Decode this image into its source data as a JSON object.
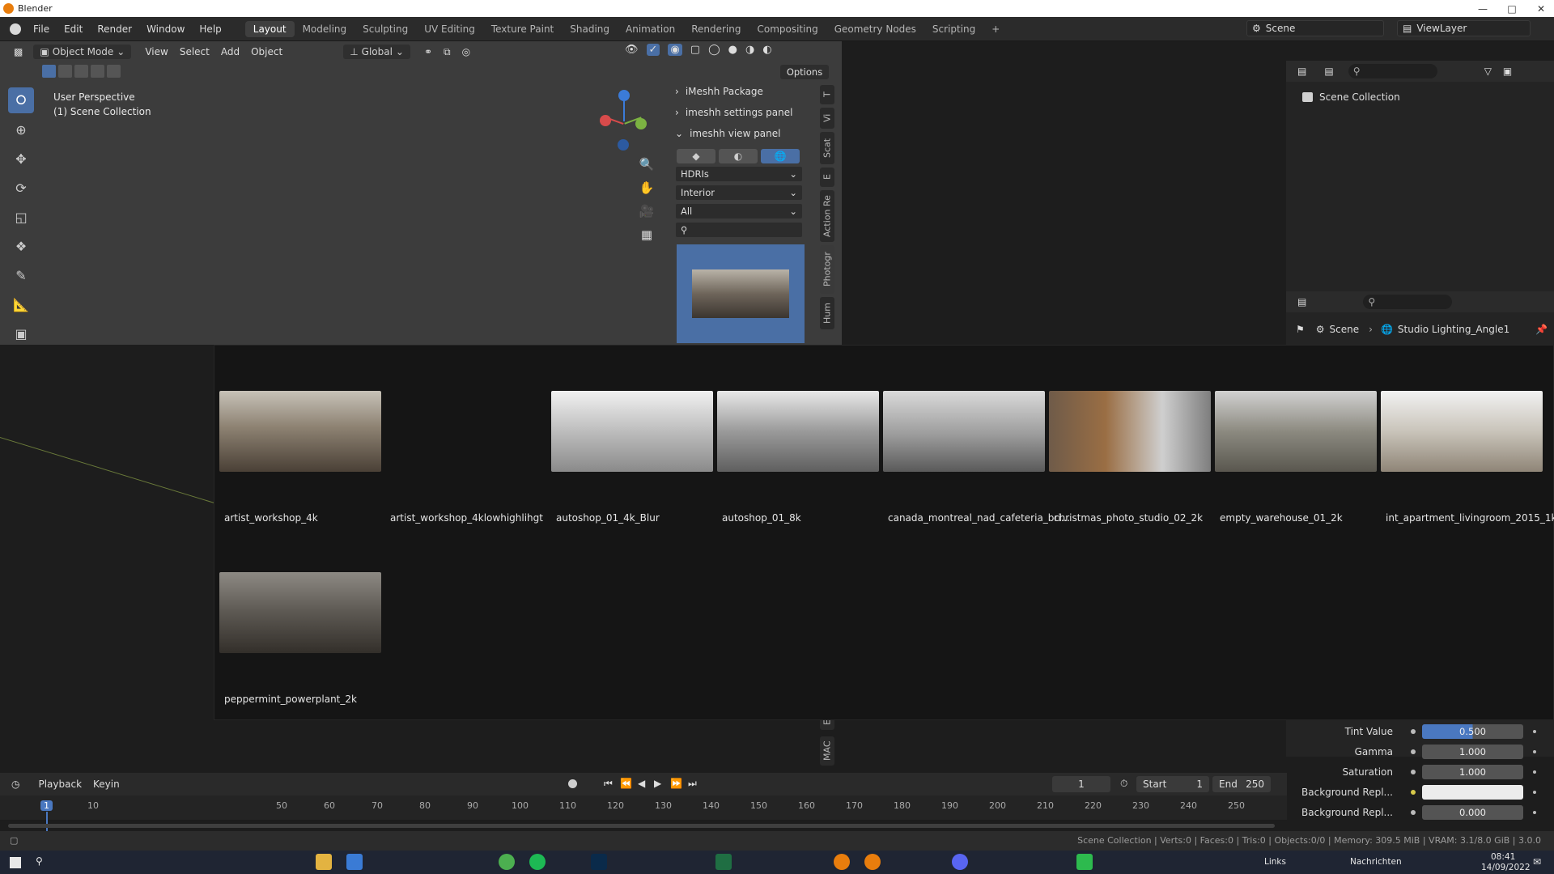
{
  "window": {
    "title": "Blender"
  },
  "menus": [
    "File",
    "Edit",
    "Render",
    "Window",
    "Help"
  ],
  "workspaces": [
    "Layout",
    "Modeling",
    "Sculpting",
    "UV Editing",
    "Texture Paint",
    "Shading",
    "Animation",
    "Rendering",
    "Compositing",
    "Geometry Nodes",
    "Scripting"
  ],
  "active_workspace": "Layout",
  "scene": {
    "name": "Scene",
    "view_layer": "ViewLayer"
  },
  "viewport": {
    "mode": "Object Mode",
    "menus": [
      "View",
      "Select",
      "Add",
      "Object"
    ],
    "orientation": "Global",
    "shading_dropdown": "Object",
    "options_label": "Options",
    "overlay_line1": "User Perspective",
    "overlay_line2": "(1) Scene Collection"
  },
  "npanel": {
    "sections": [
      {
        "label": "iMeshh Package",
        "open": false
      },
      {
        "label": "imeshh settings panel",
        "open": false
      },
      {
        "label": "imeshh view panel",
        "open": true
      }
    ],
    "type_select": "HDRIs",
    "category_select": "Interior",
    "filter_select": "All",
    "tabs": [
      "T",
      "Vi",
      "Scat",
      "E",
      "Action Re",
      "Photogr",
      "Hum",
      "E",
      "MAC"
    ]
  },
  "gallery": {
    "items": [
      {
        "label": "artist_workshop_4k",
        "has_thumb": true
      },
      {
        "label": "artist_workshop_4klowhighlihgt",
        "has_thumb": false
      },
      {
        "label": "autoshop_01_4k_Blur",
        "has_thumb": true
      },
      {
        "label": "autoshop_01_8k",
        "has_thumb": true
      },
      {
        "label": "canada_montreal_nad_cafeteria_bri...",
        "has_thumb": true
      },
      {
        "label": "christmas_photo_studio_02_2k",
        "has_thumb": true
      },
      {
        "label": "empty_warehouse_01_2k",
        "has_thumb": true
      },
      {
        "label": "int_apartment_livingroom_2015_1k",
        "has_thumb": true
      },
      {
        "label": "peppermint_powerplant_2k",
        "has_thumb": true
      }
    ]
  },
  "outliner": {
    "root": "Scene Collection"
  },
  "properties": {
    "breadcrumb": [
      "Scene",
      "Studio Lighting_Angle1"
    ],
    "rows": [
      {
        "label": "Tint Value",
        "value": "0.500",
        "fill": 0.5
      },
      {
        "label": "Gamma",
        "value": "1.000"
      },
      {
        "label": "Saturation",
        "value": "1.000"
      },
      {
        "label": "Background Repl...",
        "value": ""
      },
      {
        "label": "Background Repl...",
        "value": "0.000"
      }
    ]
  },
  "timeline": {
    "playback": "Playback",
    "keying": "Keyin",
    "current_frame": "1",
    "start_label": "Start",
    "start": "1",
    "end_label": "End",
    "end": "250",
    "ticks": [
      "1",
      "10",
      "50",
      "60",
      "70",
      "80",
      "90",
      "100",
      "110",
      "120",
      "130",
      "140",
      "150",
      "160",
      "170",
      "180",
      "190",
      "200",
      "210",
      "220",
      "230",
      "240",
      "250"
    ]
  },
  "statusbar": {
    "text": "Scene Collection | Verts:0 | Faces:0 | Tris:0 | Objects:0/0 | Memory: 309.5 MiB | VRAM: 3.1/8.0 GiB | 3.0.0"
  },
  "taskbar": {
    "links": "Links",
    "news": "Nachrichten",
    "time": "08:41",
    "date": "14/09/2022"
  }
}
